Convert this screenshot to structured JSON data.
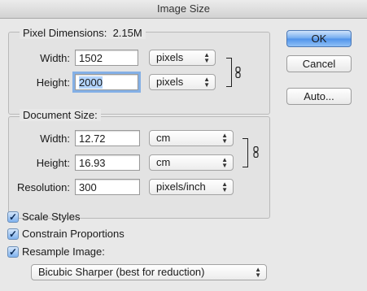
{
  "window": {
    "title": "Image Size"
  },
  "pixel_dimensions": {
    "legend": "Pixel Dimensions:",
    "size": "2.15M",
    "width": {
      "label": "Width:",
      "value": "1502",
      "unit": "pixels"
    },
    "height": {
      "label": "Height:",
      "value": "2000",
      "unit": "pixels"
    }
  },
  "document_size": {
    "legend": "Document Size:",
    "width": {
      "label": "Width:",
      "value": "12.72",
      "unit": "cm"
    },
    "height": {
      "label": "Height:",
      "value": "16.93",
      "unit": "cm"
    },
    "resolution": {
      "label": "Resolution:",
      "value": "300",
      "unit": "pixels/inch"
    }
  },
  "buttons": {
    "ok": "OK",
    "cancel": "Cancel",
    "auto": "Auto..."
  },
  "options": {
    "scale_styles": {
      "label": "Scale Styles",
      "checked": true
    },
    "constrain_proportions": {
      "label": "Constrain Proportions",
      "checked": true
    },
    "resample_image": {
      "label": "Resample Image:",
      "checked": true
    },
    "resample_method": "Bicubic Sharper (best for reduction)"
  },
  "icons": {
    "chain": "chain-link-icon",
    "select_arrows": "up-down-arrows-icon",
    "check": "checkmark-icon"
  },
  "colors": {
    "default_button": "#5b9ced",
    "focus_ring": "#84b0e6",
    "selection": "#b3d4fc"
  }
}
